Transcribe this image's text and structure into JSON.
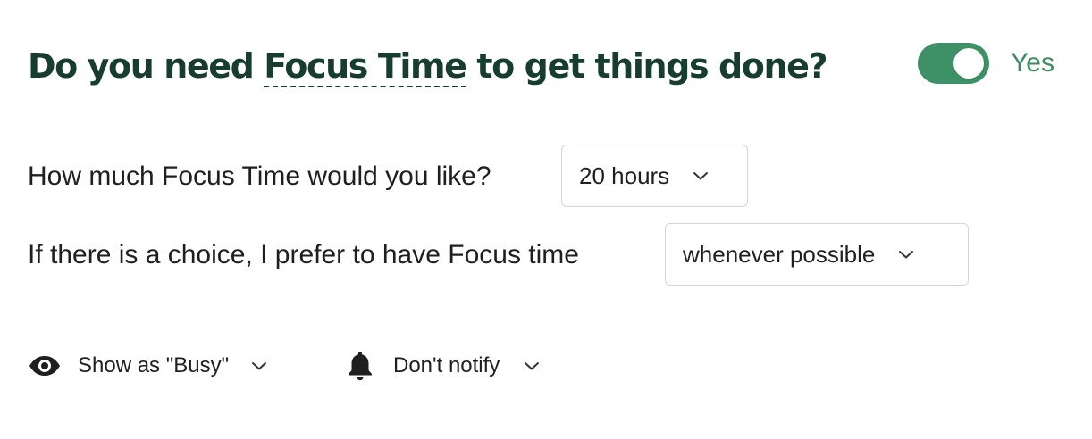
{
  "header": {
    "title_prefix": "Do you need ",
    "title_term": "Focus Time",
    "title_suffix": " to get things done?",
    "toggle_state": "on",
    "toggle_label": "Yes",
    "accent_color": "#3e9166",
    "title_color": "#173d30"
  },
  "questions": [
    {
      "label": "How much Focus Time would you like?",
      "selected_value": "20 hours",
      "icon": "chevron-down-icon"
    },
    {
      "label": "If there is a choice, I prefer to have Focus time",
      "selected_value": "whenever possible",
      "icon": "chevron-down-icon"
    }
  ],
  "options": [
    {
      "icon": "eye-icon",
      "label": "Show as \"Busy\"",
      "dropdown_icon": "chevron-down-icon"
    },
    {
      "icon": "bell-icon",
      "label": "Don't notify",
      "dropdown_icon": "chevron-down-icon"
    }
  ]
}
